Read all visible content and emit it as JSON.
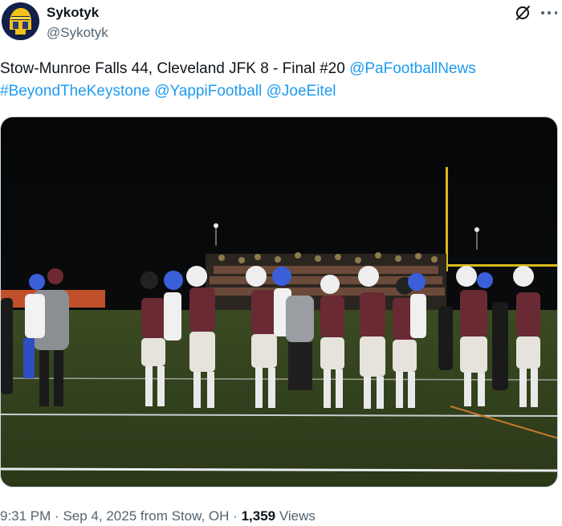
{
  "author": {
    "display_name": "Sykotyk",
    "handle": "@Sykotyk",
    "avatar_icon": "helmet-logo-icon"
  },
  "header_icons": {
    "grok": "grok-slash-icon",
    "more": "more-dots-icon"
  },
  "tweet": {
    "text_plain": "Stow-Munroe Falls 44, Cleveland JFK 8 - Final #20 ",
    "mention_1": "@PaFootballNews",
    "hashtag_1": "#BeyondTheKeystone",
    "mention_2": "@YappiFootball",
    "mention_3": "@JoeEitel",
    "link_color": "#1d9bf0"
  },
  "media": {
    "type": "photo",
    "subject": "football teams shaking hands at night game"
  },
  "meta": {
    "time": "9:31 PM",
    "date": "Sep 4, 2025",
    "location": "from Stow, OH",
    "views_count": "1,359",
    "views_label": "Views"
  }
}
